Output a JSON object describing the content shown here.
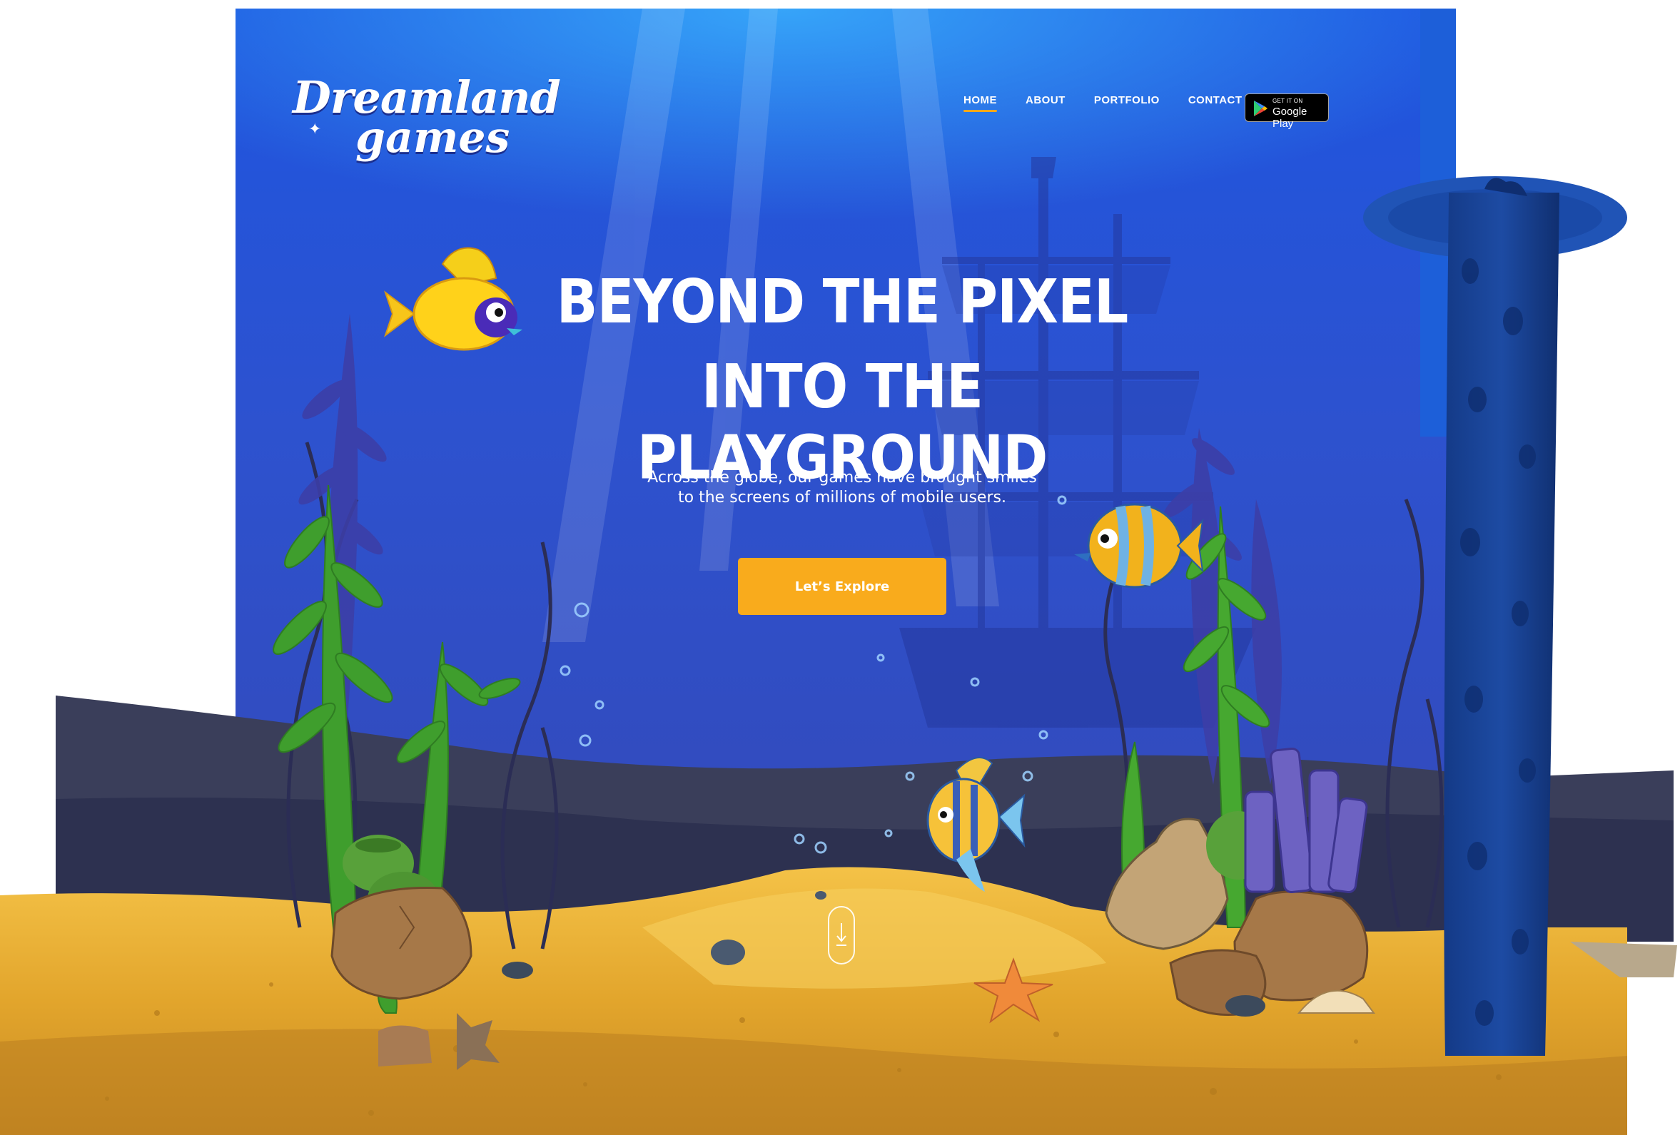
{
  "brand": {
    "logo_line1": "Dreamland",
    "logo_line2": "games"
  },
  "nav": {
    "items": [
      {
        "label": "HOME",
        "active": true
      },
      {
        "label": "ABOUT",
        "active": false
      },
      {
        "label": "PORTFOLIO",
        "active": false
      },
      {
        "label": "CONTACT",
        "active": false
      }
    ],
    "store_badge": {
      "small": "GET IT ON",
      "big": "Google Play"
    }
  },
  "hero": {
    "headline_line1": "BEYOND THE PIXEL",
    "headline_line2": "INTO THE PLAYGROUND",
    "sub_line1": "Across the globe, our games have brought smiles",
    "sub_line2": "to the screens of millions of mobile users.",
    "cta_label": "Let’s Explore"
  },
  "icons": {
    "scroll": "scroll-down-arrow-icon",
    "store": "google-play-icon"
  },
  "colors": {
    "ocean_top": "#1a4fd8",
    "ocean_mid": "#2e4ec8",
    "sand": "#e9ad2c",
    "cta": "#f9ab1c",
    "seaweed": "#3e9e2c",
    "coral": "#6f63c0",
    "pillar": "#153a85"
  }
}
